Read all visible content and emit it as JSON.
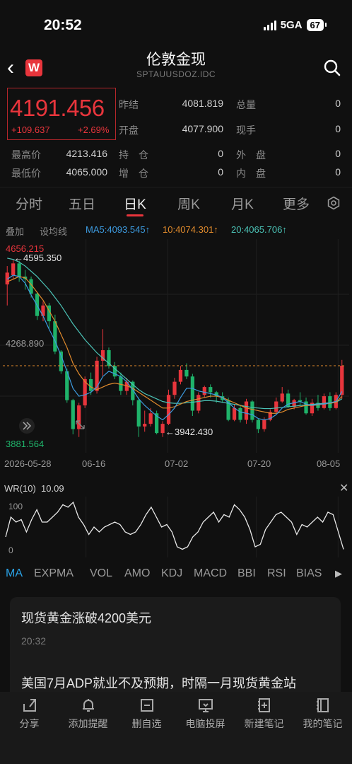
{
  "status": {
    "time": "20:52",
    "network": "5GA",
    "battery": "67"
  },
  "header": {
    "title": "伦敦金现",
    "subtitle": "SPTAUUSDOZ.IDC",
    "logo": "W"
  },
  "quote": {
    "price": "4191.456",
    "change": "+109.637",
    "change_pct": "+2.69%",
    "rows": [
      {
        "l1": "昨结",
        "v1": "4081.819",
        "l2": "总量",
        "v2": "0"
      },
      {
        "l1": "开盘",
        "v1": "4077.900",
        "l2": "现手",
        "v2": "0"
      }
    ],
    "rows2": [
      {
        "l1": "最高价",
        "v1": "4213.416",
        "l2": "持　仓",
        "v2": "0",
        "l3": "外　盘",
        "v3": "0"
      },
      {
        "l1": "最低价",
        "v1": "4065.000",
        "l2": "增　仓",
        "v2": "0",
        "l3": "内　盘",
        "v3": "0"
      }
    ]
  },
  "period_tabs": [
    "分时",
    "五日",
    "日K",
    "周K",
    "月K",
    "更多"
  ],
  "active_period": "日K",
  "ma_row": {
    "overlay": "叠加",
    "set_line": "设均线",
    "ma5": "MA5:4093.545↑",
    "ma10": "10:4074.301↑",
    "ma20": "20:4065.706↑"
  },
  "colors": {
    "up": "#e8353c",
    "down": "#1fb36a",
    "ma5": "#3d9be0",
    "ma10": "#e08a2c",
    "ma20": "#4bc2b6",
    "accent": "#2aa2e6"
  },
  "chart_data": {
    "type": "candlestick",
    "y_labels": {
      "top": "4656.215",
      "mid": "4268.890",
      "bottom": "3881.564"
    },
    "annotations": {
      "high": "←4595.350",
      "low": "←3942.430"
    },
    "ylim": [
      3881.564,
      4656.215
    ],
    "x_ticks": [
      "2026-05-28",
      "06-16",
      "07-02",
      "07-20",
      "08-05"
    ],
    "candles": [
      [
        4500,
        4545,
        4420,
        4570
      ],
      [
        4535,
        4580,
        4520,
        4595
      ],
      [
        4580,
        4530,
        4510,
        4590
      ],
      [
        4530,
        4520,
        4480,
        4555
      ],
      [
        4520,
        4465,
        4450,
        4530
      ],
      [
        4465,
        4380,
        4365,
        4470
      ],
      [
        4380,
        4420,
        4360,
        4435
      ],
      [
        4420,
        4360,
        4330,
        4430
      ],
      [
        4360,
        4245,
        4235,
        4385
      ],
      [
        4245,
        4170,
        4160,
        4250
      ],
      [
        4170,
        4060,
        4050,
        4180
      ],
      [
        4060,
        3950,
        3930,
        4065
      ],
      [
        3950,
        4040,
        3920,
        4050
      ],
      [
        4040,
        4140,
        4030,
        4150
      ],
      [
        4140,
        4095,
        4080,
        4165
      ],
      [
        4095,
        4210,
        4085,
        4225
      ],
      [
        4210,
        4250,
        4150,
        4330
      ],
      [
        4250,
        4190,
        4180,
        4260
      ],
      [
        4190,
        4150,
        4140,
        4205
      ],
      [
        4150,
        4095,
        4080,
        4165
      ],
      [
        4095,
        4130,
        4080,
        4145
      ],
      [
        4130,
        4060,
        4040,
        4135
      ],
      [
        4060,
        3960,
        3920,
        4070
      ],
      [
        3960,
        3970,
        3940,
        4020
      ],
      [
        3970,
        4010,
        3960,
        4030
      ],
      [
        4010,
        3935,
        3930,
        4020
      ],
      [
        3935,
        3970,
        3920,
        3980
      ],
      [
        3970,
        4080,
        3965,
        4100
      ],
      [
        4080,
        4130,
        4065,
        4145
      ],
      [
        4130,
        4175,
        4120,
        4190
      ],
      [
        4175,
        4150,
        4140,
        4200
      ],
      [
        4150,
        4020,
        4000,
        4160
      ],
      [
        4020,
        4080,
        4010,
        4090
      ],
      [
        4080,
        4110,
        4070,
        4115
      ],
      [
        4110,
        4090,
        4070,
        4120
      ],
      [
        4090,
        4075,
        4050,
        4095
      ],
      [
        4075,
        4060,
        4050,
        4090
      ],
      [
        4060,
        3985,
        3980,
        4070
      ],
      [
        3985,
        4030,
        3980,
        4045
      ],
      [
        4030,
        3985,
        3975,
        4040
      ],
      [
        3985,
        4055,
        3970,
        4065
      ],
      [
        4055,
        3985,
        3975,
        4060
      ],
      [
        3985,
        3950,
        3935,
        3990
      ],
      [
        3950,
        3985,
        3940,
        3995
      ],
      [
        3985,
        4015,
        3980,
        4025
      ],
      [
        4015,
        4055,
        4010,
        4070
      ],
      [
        4055,
        4085,
        4050,
        4110
      ],
      [
        4085,
        4035,
        4030,
        4100
      ],
      [
        4035,
        4060,
        4025,
        4065
      ],
      [
        4060,
        4055,
        4040,
        4090
      ],
      [
        4055,
        4010,
        4005,
        4070
      ],
      [
        4010,
        4050,
        4000,
        4065
      ],
      [
        4050,
        4030,
        4020,
        4080
      ],
      [
        4030,
        4075,
        4025,
        4085
      ],
      [
        4075,
        4030,
        4020,
        4090
      ],
      [
        4030,
        4080,
        4025,
        4090
      ],
      [
        4080,
        4191,
        4065,
        4213
      ]
    ],
    "ma5": [
      4520,
      4535,
      4530,
      4505,
      4460,
      4420,
      4380,
      4330,
      4285,
      4230,
      4170,
      4105,
      4075,
      4080,
      4090,
      4110,
      4150,
      4170,
      4160,
      4150,
      4130,
      4100,
      4065,
      4040,
      4020,
      4000,
      3985,
      4005,
      4030,
      4070,
      4105,
      4105,
      4095,
      4090,
      4085,
      4080,
      4070,
      4050,
      4030,
      4015,
      4010,
      4005,
      3990,
      3985,
      3990,
      4005,
      4030,
      4045,
      4050,
      4055,
      4045,
      4040,
      4045,
      4045,
      4050,
      4055,
      4093
    ],
    "ma10": [
      4510,
      4520,
      4530,
      4525,
      4500,
      4470,
      4440,
      4400,
      4360,
      4310,
      4260,
      4200,
      4160,
      4130,
      4110,
      4100,
      4110,
      4120,
      4125,
      4120,
      4115,
      4105,
      4090,
      4075,
      4060,
      4045,
      4030,
      4030,
      4035,
      4045,
      4055,
      4060,
      4065,
      4070,
      4075,
      4075,
      4070,
      4060,
      4050,
      4040,
      4030,
      4025,
      4020,
      4015,
      4010,
      4010,
      4015,
      4025,
      4030,
      4035,
      4040,
      4040,
      4042,
      4045,
      4048,
      4052,
      4074
    ],
    "ma20": [
      4600,
      4595,
      4585,
      4570,
      4550,
      4530,
      4505,
      4480,
      4450,
      4420,
      4385,
      4350,
      4320,
      4290,
      4265,
      4240,
      4220,
      4200,
      4180,
      4160,
      4140,
      4120,
      4100,
      4085,
      4075,
      4065,
      4055,
      4050,
      4048,
      4048,
      4050,
      4052,
      4055,
      4058,
      4058,
      4056,
      4052,
      4048,
      4044,
      4040,
      4036,
      4032,
      4030,
      4028,
      4028,
      4030,
      4032,
      4035,
      4037,
      4040,
      4042,
      4044,
      4046,
      4048,
      4050,
      4052,
      4065
    ]
  },
  "wr": {
    "title": "WR(10)",
    "value": "10.09",
    "label_top": "100",
    "label_bottom": "0",
    "values": [
      30,
      70,
      60,
      65,
      40,
      65,
      85,
      60,
      60,
      70,
      80,
      95,
      90,
      100,
      70,
      55,
      35,
      50,
      40,
      50,
      55,
      60,
      55,
      40,
      35,
      40,
      55,
      75,
      90,
      70,
      50,
      55,
      40,
      10,
      5,
      10,
      30,
      40,
      60,
      70,
      80,
      60,
      75,
      70,
      95,
      85,
      70,
      45,
      10,
      15,
      45,
      60,
      75,
      80,
      70,
      60,
      35,
      55,
      50,
      60,
      70,
      60,
      80,
      75,
      40,
      5
    ]
  },
  "indicator_tabs": [
    "MA",
    "EXPMA",
    "VOL",
    "AMO",
    "KDJ",
    "MACD",
    "BBI",
    "RSI",
    "BIAS"
  ],
  "news": [
    {
      "title": "现货黄金涨破4200美元",
      "time": "20:32"
    },
    {
      "title": "美国7月ADP就业不及预期，时隔一月现货黄金站"
    }
  ],
  "bottom_bar": [
    "分享",
    "添加提醒",
    "删自选",
    "电脑投屏",
    "新建笔记",
    "我的笔记"
  ]
}
